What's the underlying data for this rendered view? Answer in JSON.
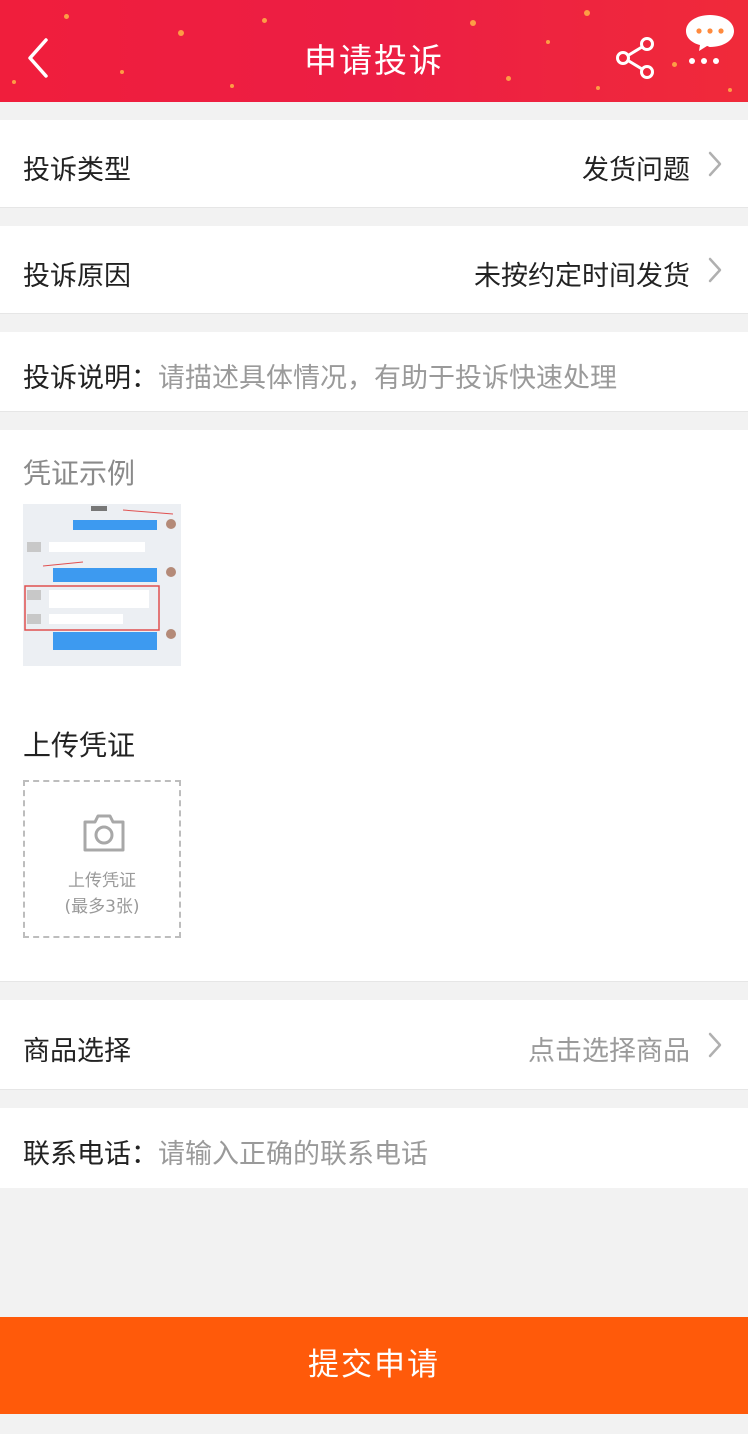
{
  "header": {
    "title": "申请投诉",
    "back_icon": "chevron-left-icon",
    "share_icon": "share-icon",
    "message_icon": "message-bubble-icon"
  },
  "form": {
    "complaint_type": {
      "label": "投诉类型",
      "value": "发货问题"
    },
    "complaint_reason": {
      "label": "投诉原因",
      "value": "未按约定时间发货"
    },
    "complaint_desc": {
      "label": "投诉说明：",
      "placeholder": "请描述具体情况，有助于投诉快速处理"
    },
    "evidence_example": {
      "title": "凭证示例"
    },
    "upload": {
      "title": "上传凭证",
      "button_line1": "上传凭证",
      "button_line2": "(最多3张)"
    },
    "product_select": {
      "label": "商品选择",
      "placeholder": "点击选择商品"
    },
    "phone": {
      "label": "联系电话：",
      "placeholder": "请输入正确的联系电话"
    }
  },
  "submit": {
    "label": "提交申请"
  },
  "colors": {
    "header_bg": "#f01e3c",
    "submit_bg": "#ff5a0a",
    "placeholder": "#9a9a9a"
  }
}
